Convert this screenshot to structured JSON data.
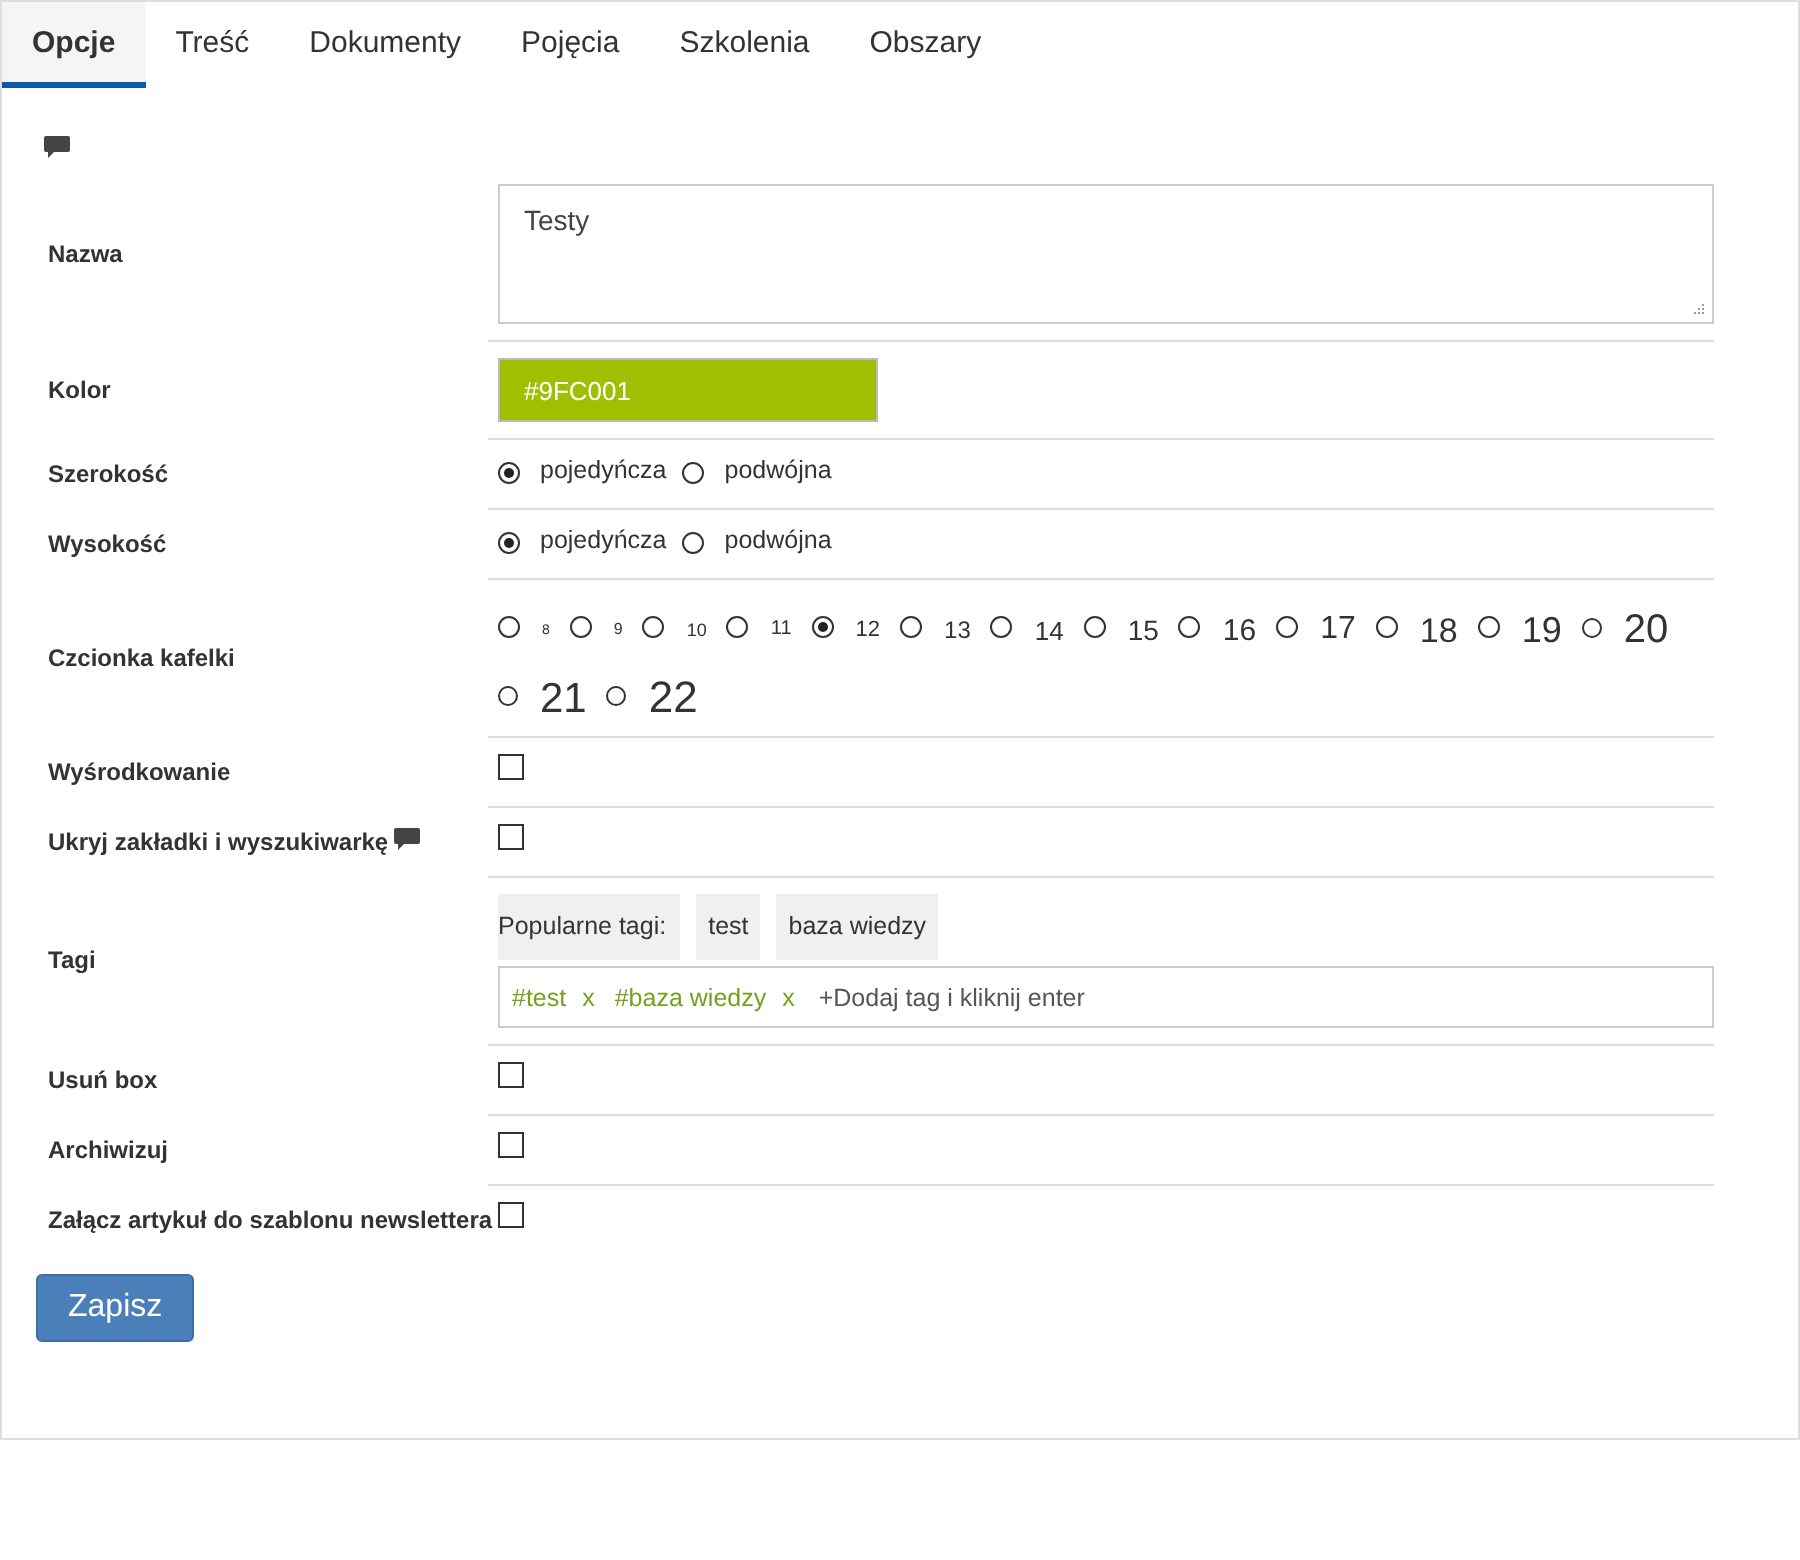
{
  "tabs": [
    {
      "label": "Opcje",
      "selected": true
    },
    {
      "label": "Treść",
      "selected": false
    },
    {
      "label": "Dokumenty",
      "selected": false
    },
    {
      "label": "Pojęcia",
      "selected": false
    },
    {
      "label": "Szkolenia",
      "selected": false
    },
    {
      "label": "Obszary",
      "selected": false
    }
  ],
  "fields": [
    {
      "kind": "textarea",
      "label": "Nazwa",
      "value": "Testy"
    },
    {
      "kind": "color",
      "label": "Kolor",
      "value": "#9FC001",
      "color": "#9fc001"
    },
    {
      "kind": "radio",
      "label": "Szerokość",
      "options": [
        {
          "label": "pojedyńcza",
          "selected": true
        },
        {
          "label": "podwójna",
          "selected": false
        }
      ]
    },
    {
      "kind": "radio",
      "label": "Wysokość",
      "options": [
        {
          "label": "pojedyńcza",
          "selected": true
        },
        {
          "label": "podwójna",
          "selected": false
        }
      ]
    },
    {
      "kind": "fontsize",
      "label": "Czcionka kafelki",
      "options": [
        {
          "label": "8",
          "selected": false
        },
        {
          "label": "9",
          "selected": false
        },
        {
          "label": "10",
          "selected": false
        },
        {
          "label": "11",
          "selected": false
        },
        {
          "label": "12",
          "selected": true
        },
        {
          "label": "13",
          "selected": false
        },
        {
          "label": "14",
          "selected": false
        },
        {
          "label": "15",
          "selected": false
        },
        {
          "label": "16",
          "selected": false
        },
        {
          "label": "17",
          "selected": false
        },
        {
          "label": "18",
          "selected": false
        },
        {
          "label": "19",
          "selected": false
        },
        {
          "label": "20",
          "selected": false
        },
        {
          "label": "21",
          "selected": false
        },
        {
          "label": "22",
          "selected": false
        }
      ]
    },
    {
      "kind": "checkbox",
      "label": "Wyśrodkowanie",
      "checked": false
    },
    {
      "kind": "checkbox",
      "label": "Ukryj zakładki i wyszukiwarkę",
      "hint": true,
      "checked": false
    },
    {
      "kind": "tags",
      "label": "Tagi",
      "popular_label": "Popularne tagi:",
      "popular": [
        "test",
        "baza wiedzy"
      ],
      "tags": [
        {
          "text": "#test",
          "remove": "x"
        },
        {
          "text": "#baza wiedzy",
          "remove": "x"
        }
      ],
      "placeholder": "+Dodaj tag i kliknij enter"
    },
    {
      "kind": "checkbox",
      "label": "Usuń box",
      "checked": false
    },
    {
      "kind": "checkbox",
      "label": "Archiwizuj",
      "checked": false
    },
    {
      "kind": "checkbox",
      "label": "Załącz artykuł do szablonu newslettera",
      "checked": false
    }
  ],
  "save_button": "Zapisz"
}
